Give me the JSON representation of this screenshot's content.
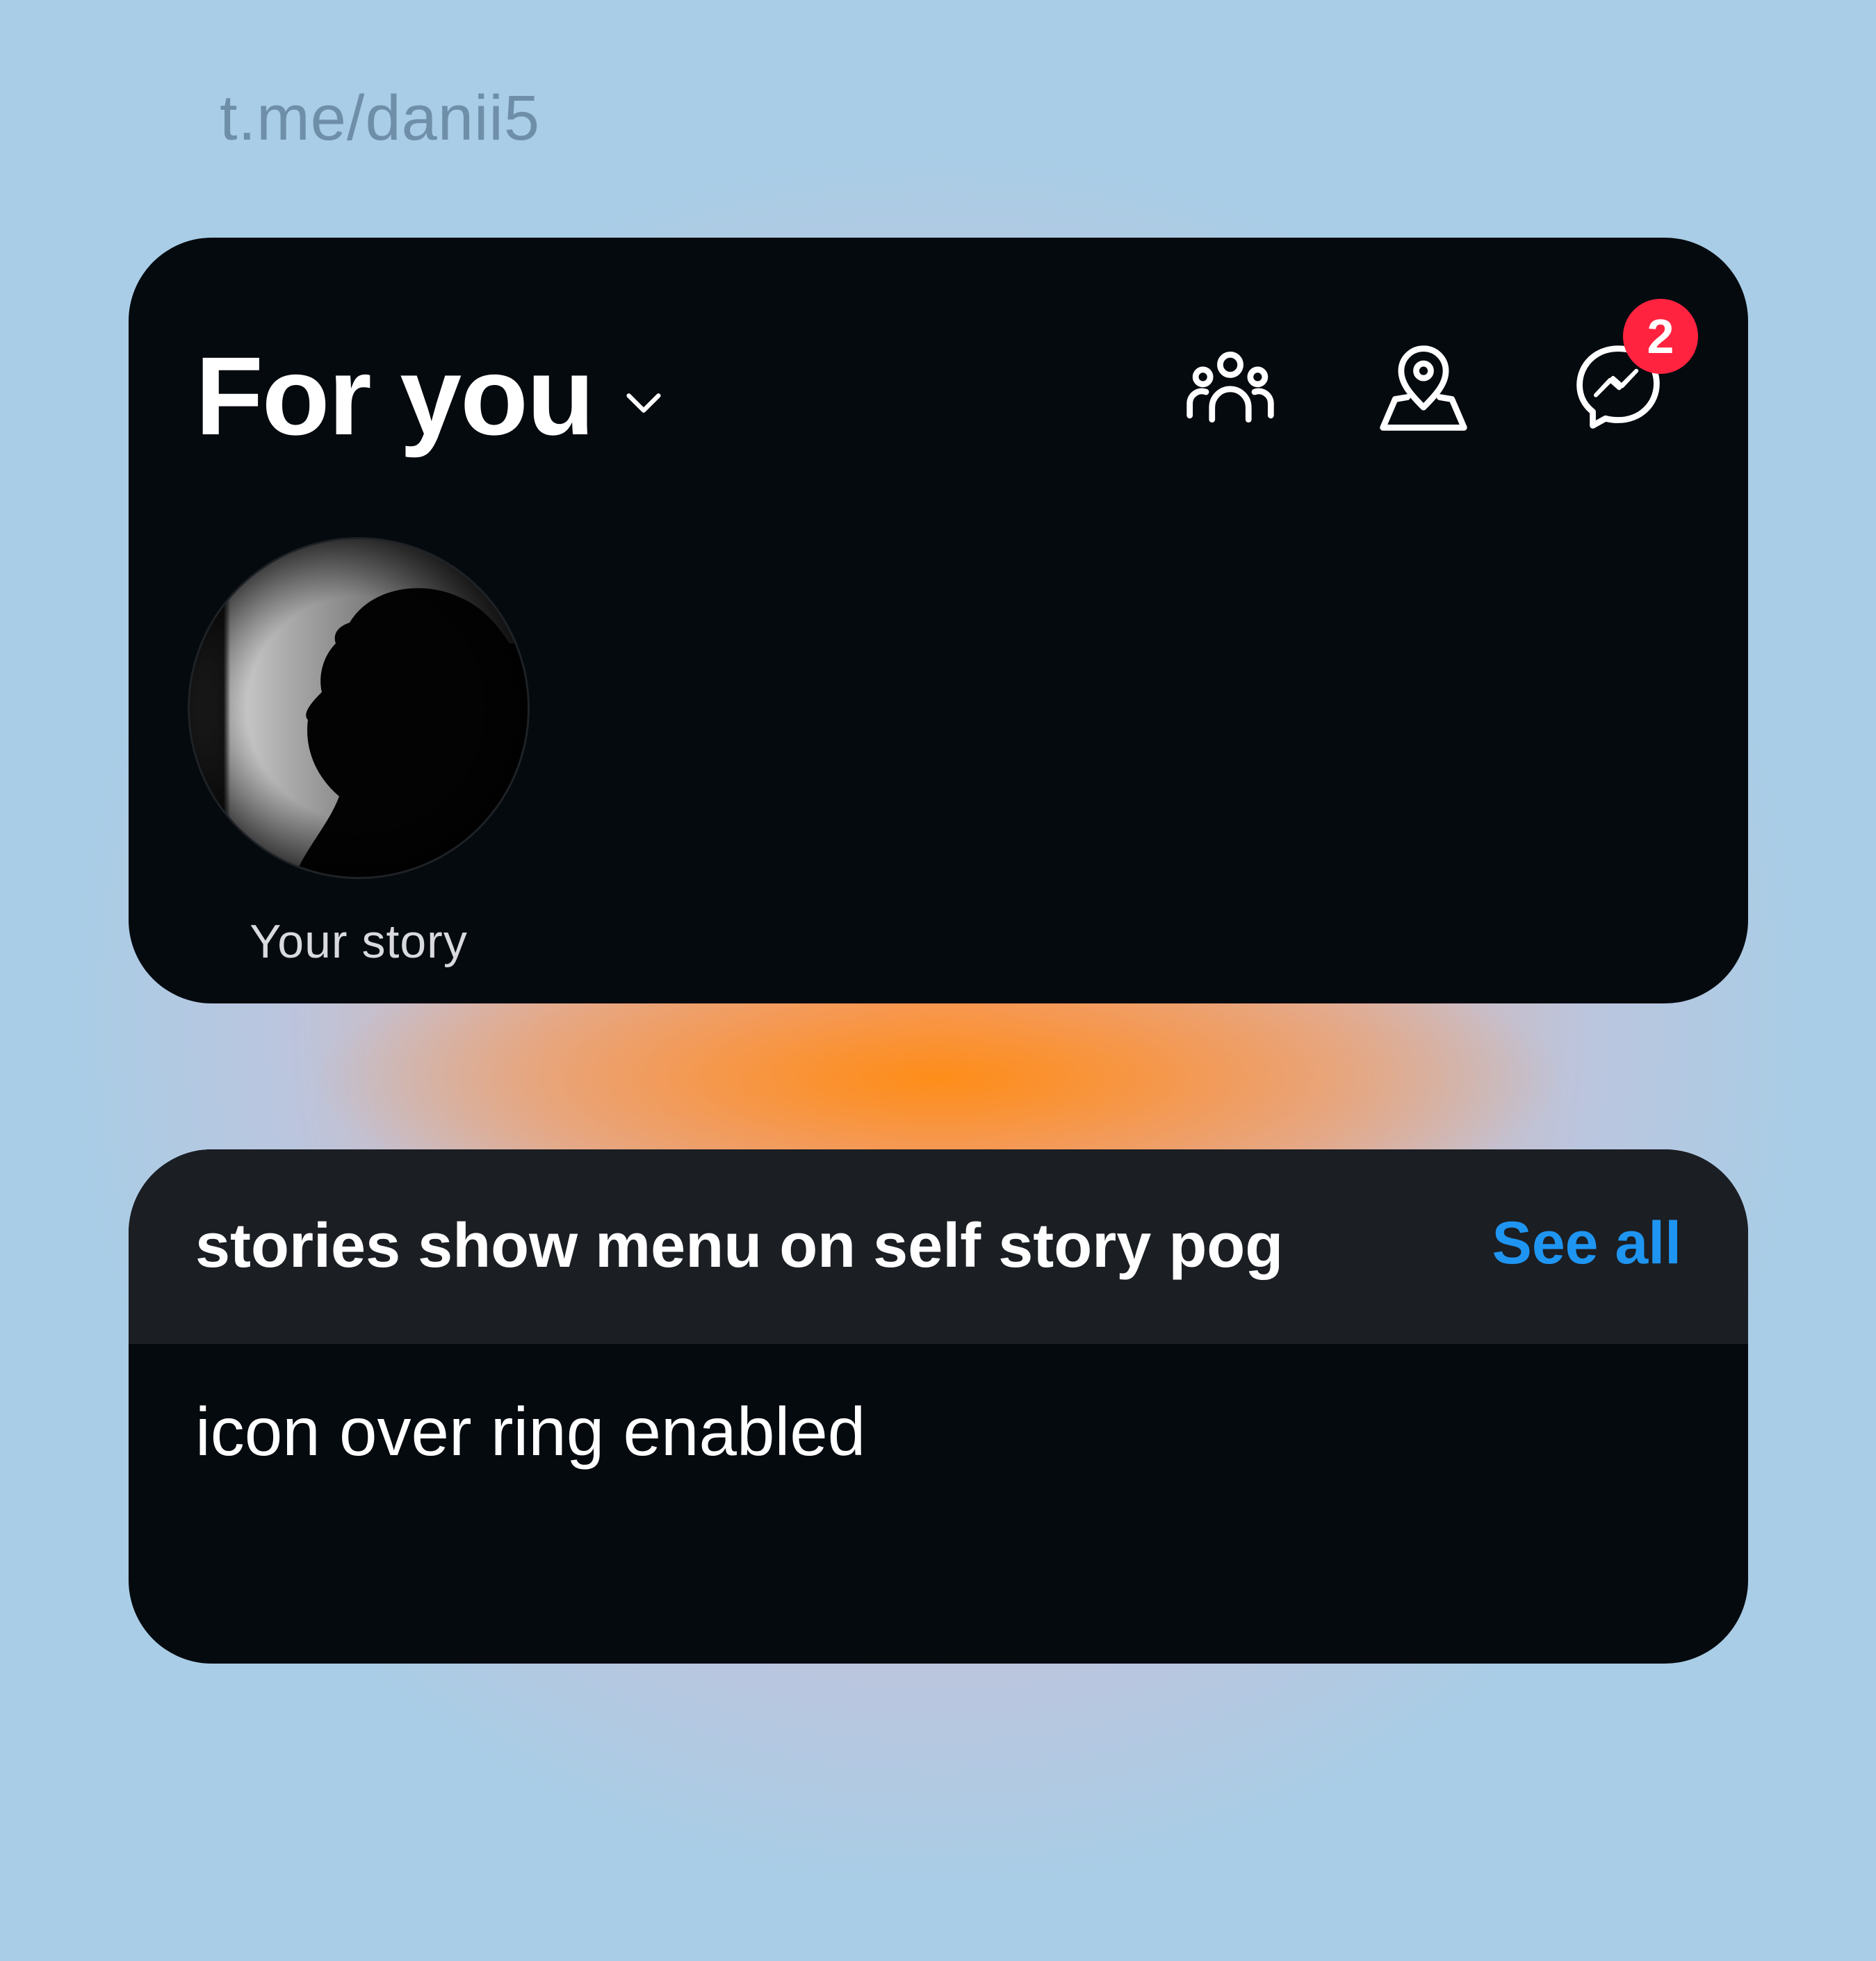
{
  "watermark": "t.me/danii5",
  "header": {
    "title": "For you",
    "title_icon": "chevron-down-icon",
    "actions": [
      {
        "icon": "friends-icon"
      },
      {
        "icon": "map-pin-icon"
      },
      {
        "icon": "messenger-icon"
      }
    ],
    "messenger_badge": "2"
  },
  "stories": [
    {
      "label": "Your story"
    }
  ],
  "section": {
    "title": "stories show menu on self story pog",
    "see_all": "See all",
    "body": "icon over ring enabled"
  },
  "colors": {
    "card_background": "#050a0f",
    "section_header_background": "#1b1e23",
    "link_blue": "#1f95f2",
    "badge_red": "#ff2340",
    "watermark": "#6f8fa9"
  }
}
